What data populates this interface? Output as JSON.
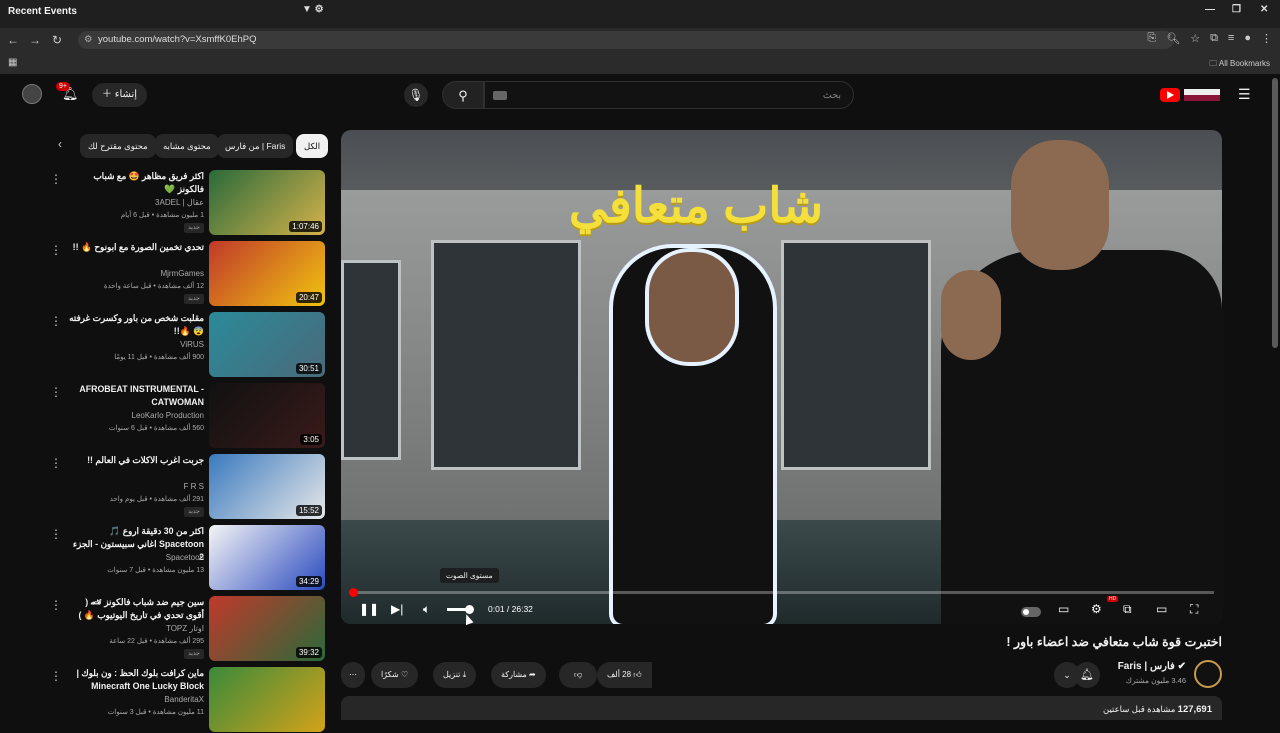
{
  "window": {
    "title": "Recent Events",
    "controls": [
      "—",
      "❐",
      "✕"
    ]
  },
  "browser": {
    "url": "youtube.com/watch?v=XsmffK0EhPQ",
    "bookmarks_label": "All Bookmarks"
  },
  "masthead": {
    "create_label": "إنشاء",
    "notif_count": "9+",
    "search_placeholder": "بحث"
  },
  "chips": [
    "الكل",
    "من فارس | Faris",
    "محتوى مشابه",
    "محتوى مقترح لك"
  ],
  "recommendations": [
    {
      "title": "اكثر فريق مظاهر 🤩 مع شباب فالكونز 💚",
      "channel": "عقال | 3ADEL",
      "meta": "1 مليون مشاهدة • قبل 6 أيام",
      "duration": "1:07:46",
      "badge": "جديد",
      "colors": [
        "#2a6a3a",
        "#d4b24a"
      ]
    },
    {
      "title": "تحدي تخمين الصورة مع ابونوح 🔥 !!",
      "channel": "MjrmGames",
      "meta": "12 ألف مشاهدة • قبل ساعة واحدة",
      "duration": "20:47",
      "badge": "جديد",
      "colors": [
        "#c0392b",
        "#f1c40f"
      ]
    },
    {
      "title": "مقلبت شخص من باور وكسرت غرفته 😨 🔥!!",
      "channel": "ViRUS",
      "meta": "900 ألف مشاهدة • قبل 11 يومًا",
      "duration": "30:51",
      "badge": "",
      "colors": [
        "#2a8a9a",
        "#4a6a7a"
      ]
    },
    {
      "title": "AFROBEAT INSTRUMENTAL - CATWOMAN",
      "channel": "LeoKarlo Production",
      "meta": "560 ألف مشاهدة • قبل 6 سنوات",
      "duration": "3:05",
      "badge": "",
      "colors": [
        "#111",
        "#3a1a1a"
      ]
    },
    {
      "title": "جربت اغرب الاكلات في العالم !!",
      "channel": "F R S",
      "meta": "291 ألف مشاهدة • قبل يوم واحد",
      "duration": "15:52",
      "badge": "جديد",
      "colors": [
        "#3a7abf",
        "#e8e8e8"
      ]
    },
    {
      "title": "اكثر من 30 دقيقة اروع 🎵 Spacetoon اغاني سبيستون - الجزء 2",
      "channel": "Spacetoon",
      "meta": "13 مليون مشاهدة • قبل 7 سنوات",
      "duration": "34:29",
      "badge": "",
      "colors": [
        "#f5f5f5",
        "#2a4abf"
      ]
    },
    {
      "title": "سين جيم ضد شباب فالكونز 🏎 ( أقوى تحدي في تاريخ اليوتيوب 🔥 )",
      "channel": "اوتار TOPZ",
      "meta": "295 ألف مشاهدة • قبل 22 ساعة",
      "duration": "39:32",
      "badge": "جديد",
      "colors": [
        "#c0392b",
        "#2a6a3a"
      ]
    },
    {
      "title": "ماين كرافت بلوك الحظ : ون بلوك | Minecraft One Lucky Block",
      "channel": "BanderitaX",
      "meta": "11 مليون مشاهدة • قبل 3 سنوات",
      "duration": "",
      "badge": "",
      "colors": [
        "#3a8a3a",
        "#d4a21a"
      ]
    }
  ],
  "video": {
    "overlay_text": "شاب متعافي",
    "title": "اختبرت قوة شاب متعافي ضد اعضاء باور !",
    "time": "0:01 / 26:32",
    "tooltip": "مستوى الصوت",
    "progress": 0.001,
    "volume": 0.7,
    "hd_badge": "HD"
  },
  "channel": {
    "name": "فارس | Faris",
    "subs": "3.46 مليون مشترك"
  },
  "actions": {
    "like": "28 ألف",
    "share": "مشاركة",
    "download": "تنزيل",
    "thanks": "شكرًا"
  },
  "description": {
    "views": "127,691",
    "views_label": "مشاهدة",
    "time": "قبل ساعتين"
  }
}
